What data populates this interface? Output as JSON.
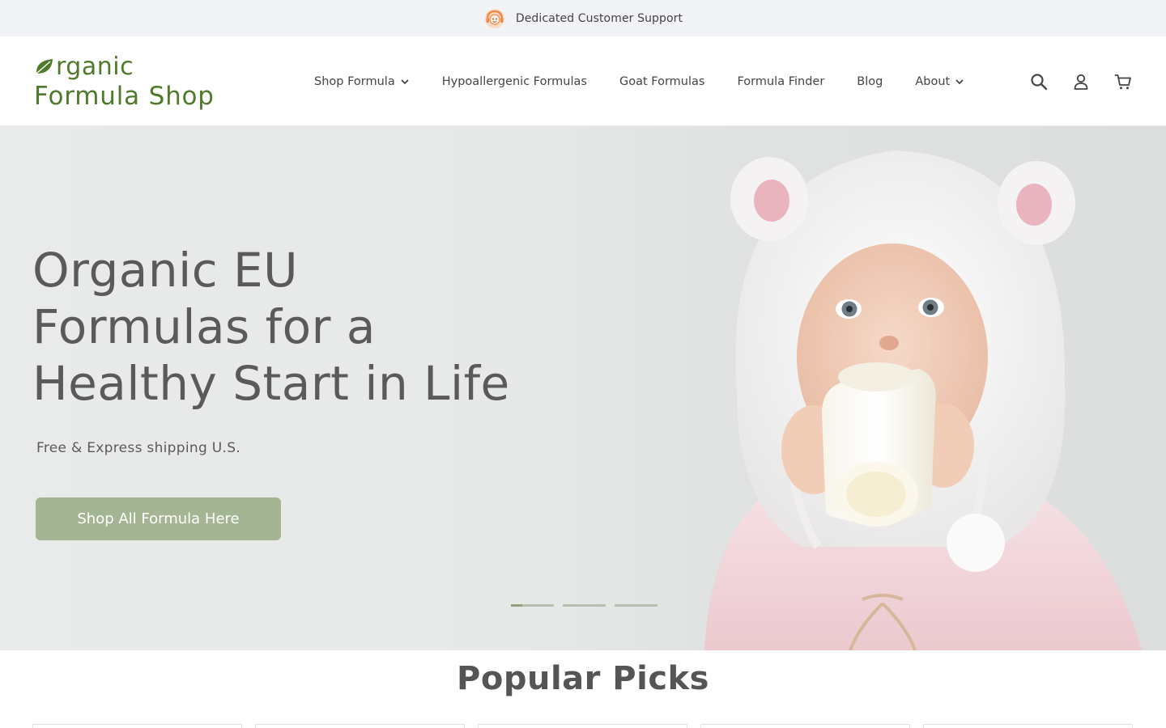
{
  "announcement": {
    "text": "Dedicated Customer Support",
    "icon": "support-agent-icon"
  },
  "header": {
    "logo": {
      "line1": "rganic",
      "line2": "Formula Shop",
      "brand_color": "#4f7a2c"
    },
    "nav": [
      {
        "label": "Shop Formula",
        "has_dropdown": true
      },
      {
        "label": "Hypoallergenic Formulas",
        "has_dropdown": false
      },
      {
        "label": "Goat Formulas",
        "has_dropdown": false
      },
      {
        "label": "Formula Finder",
        "has_dropdown": false
      },
      {
        "label": "Blog",
        "has_dropdown": false
      },
      {
        "label": "About",
        "has_dropdown": true
      }
    ],
    "icons": [
      "search-icon",
      "account-icon",
      "cart-icon"
    ]
  },
  "hero": {
    "title_lines": [
      "Organic EU",
      "Formulas for a",
      "Healthy Start in Life"
    ],
    "subtitle": "Free & Express shipping U.S.",
    "cta_label": "Shop All Formula Here",
    "cta_color": "#a3b593",
    "slides_total": 3,
    "active_slide": 1
  },
  "popular": {
    "title": "Popular Picks",
    "card_count": 5
  }
}
